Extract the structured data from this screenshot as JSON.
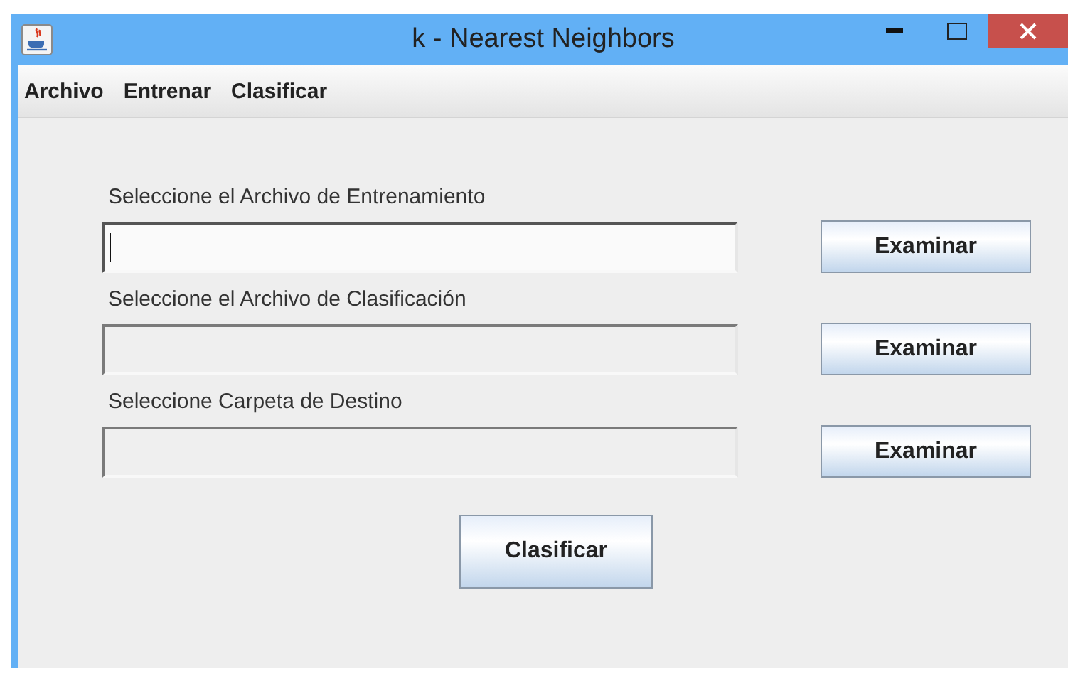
{
  "window": {
    "title": "k - Nearest Neighbors"
  },
  "menu": [
    "Archivo",
    "Entrenar",
    "Clasificar"
  ],
  "rows": [
    {
      "label": "Seleccione el Archivo de Entrenamiento",
      "focused": true,
      "button": "Examinar"
    },
    {
      "label": "Seleccione el Archivo de Clasificación",
      "focused": false,
      "button": "Examinar"
    },
    {
      "label": "Seleccione Carpeta de Destino",
      "focused": false,
      "button": "Examinar"
    }
  ],
  "action_button": "Clasificar"
}
